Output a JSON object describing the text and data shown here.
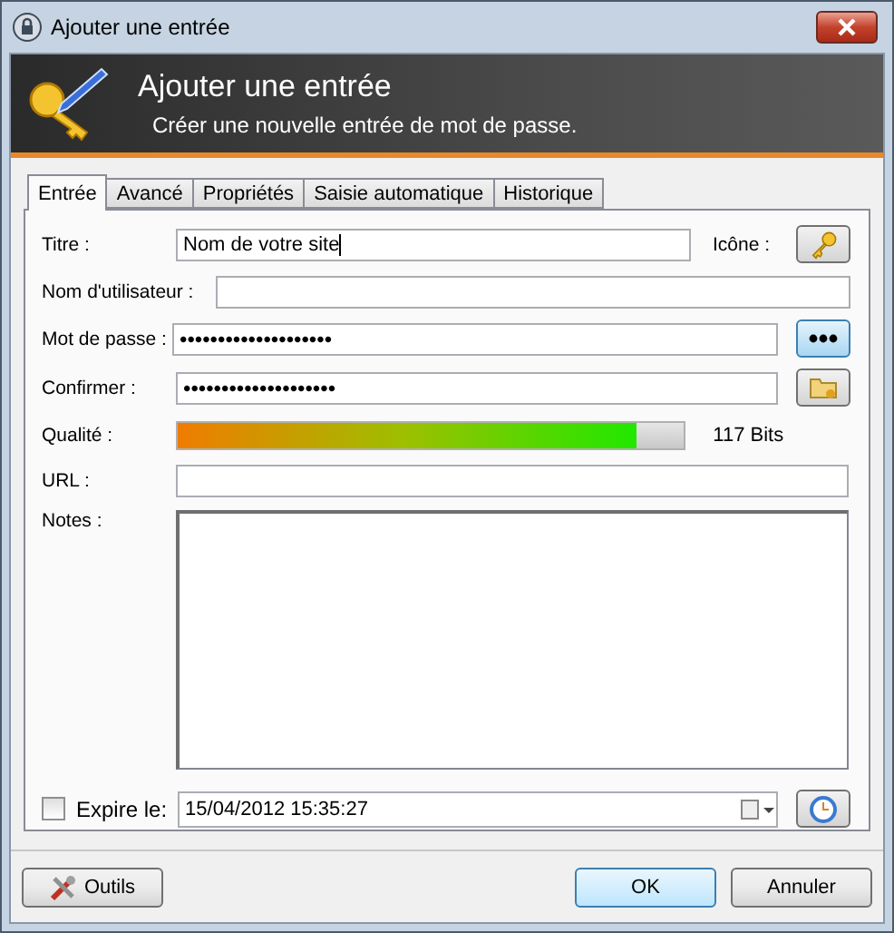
{
  "window": {
    "title": "Ajouter une entrée"
  },
  "header": {
    "title": "Ajouter une entrée",
    "subtitle": "Créer une nouvelle entrée de mot de passe."
  },
  "tabs": [
    {
      "label": "Entrée",
      "selected": true
    },
    {
      "label": "Avancé",
      "selected": false
    },
    {
      "label": "Propriétés",
      "selected": false
    },
    {
      "label": "Saisie automatique",
      "selected": false
    },
    {
      "label": "Historique",
      "selected": false
    }
  ],
  "form": {
    "title": {
      "label": "Titre :",
      "value": "Nom de votre site"
    },
    "icon_label": "Icône :",
    "username": {
      "label": "Nom d'utilisateur :"
    },
    "password": {
      "label": "Mot de passe :",
      "value": "••••••••••••••••••••"
    },
    "confirm": {
      "label": "Confirmer :",
      "value": "••••••••••••••••••••"
    },
    "quality": {
      "label": "Qualité :",
      "level": 0.908,
      "reading": "117 Bits"
    },
    "url": {
      "label": "URL :"
    },
    "notes": {
      "label": "Notes :"
    },
    "expiry": {
      "label": "Expire le:",
      "checked": false,
      "value": "15/04/2012 15:35:27"
    }
  },
  "buttons": {
    "tools": "Outils",
    "ok": "OK",
    "cancel": "Annuler"
  }
}
